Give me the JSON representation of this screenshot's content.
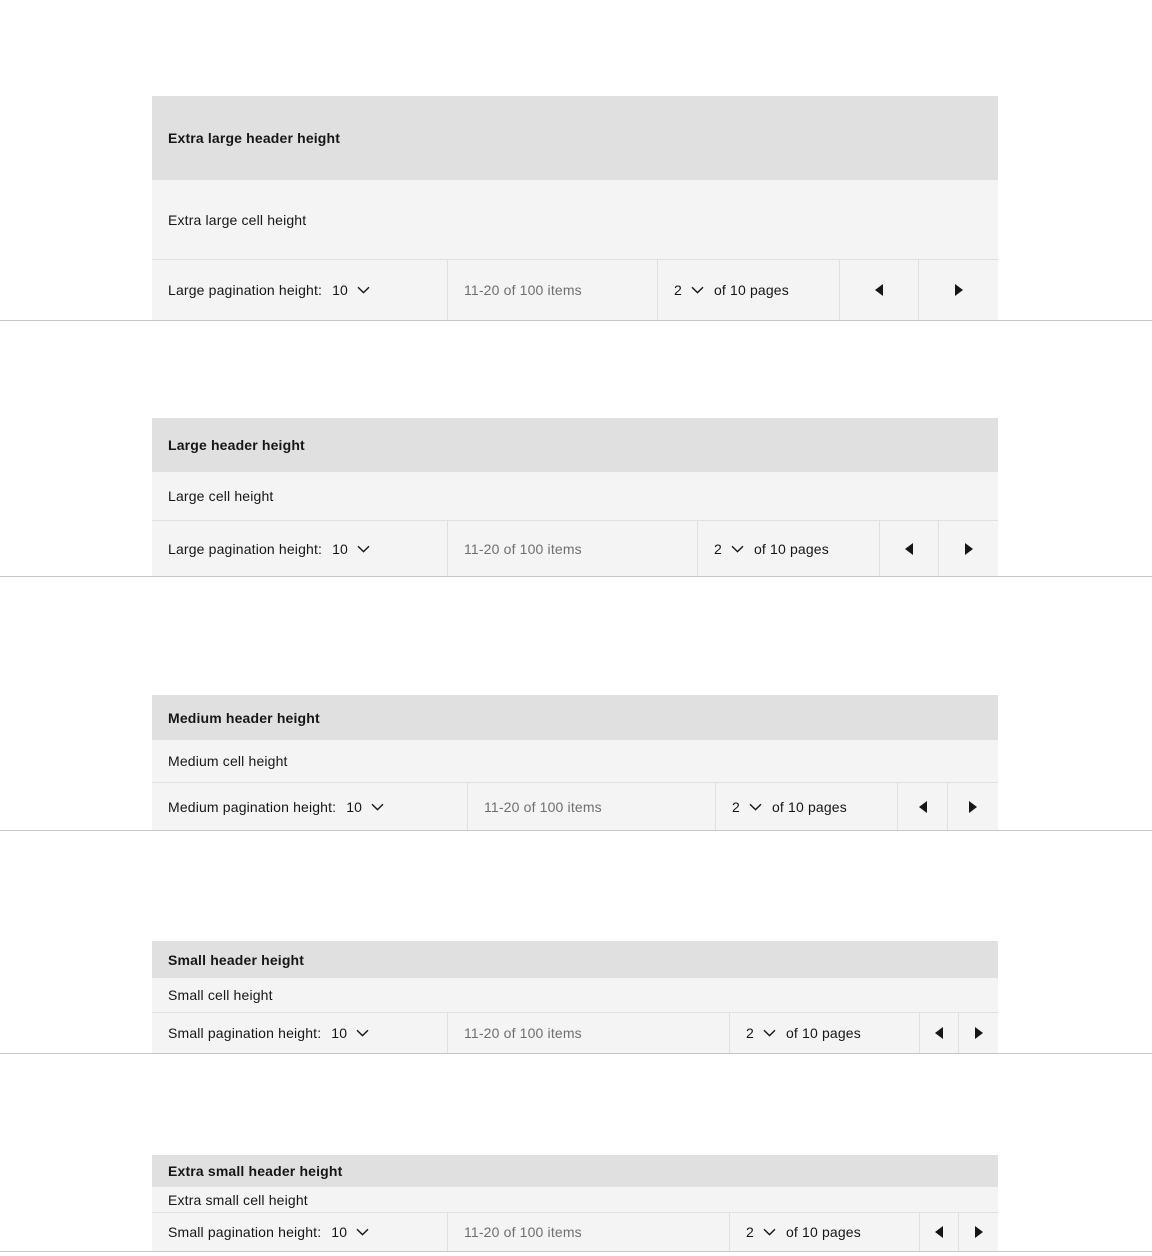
{
  "tables": [
    {
      "id": "xl",
      "header": "Extra large header height",
      "cell": "Extra large cell height",
      "pagination": {
        "page_size_label": "Large pagination height:",
        "page_size_value": "10",
        "item_range": "11-20 of 100 items",
        "page_value": "2",
        "page_total_label": "of 10 pages",
        "prev_label": "Previous page",
        "next_label": "Next page"
      }
    },
    {
      "id": "lg",
      "header": "Large header height",
      "cell": "Large cell height",
      "pagination": {
        "page_size_label": "Large pagination height:",
        "page_size_value": "10",
        "item_range": "11-20 of 100 items",
        "page_value": "2",
        "page_total_label": "of 10 pages",
        "prev_label": "Previous page",
        "next_label": "Next page"
      }
    },
    {
      "id": "md",
      "header": "Medium header height",
      "cell": "Medium cell height",
      "pagination": {
        "page_size_label": "Medium pagination height:",
        "page_size_value": "10",
        "item_range": "11-20 of 100 items",
        "page_value": "2",
        "page_total_label": "of 10 pages",
        "prev_label": "Previous page",
        "next_label": "Next page"
      }
    },
    {
      "id": "sm",
      "header": "Small header height",
      "cell": "Small cell height",
      "pagination": {
        "page_size_label": "Small pagination height:",
        "page_size_value": "10",
        "item_range": "11-20 of 100 items",
        "page_value": "2",
        "page_total_label": "of 10 pages",
        "prev_label": "Previous page",
        "next_label": "Next page"
      }
    },
    {
      "id": "xs",
      "header": "Extra small header height",
      "cell": "Extra small cell height",
      "pagination": {
        "page_size_label": "Small pagination height:",
        "page_size_value": "10",
        "item_range": "11-20 of 100 items",
        "page_value": "2",
        "page_total_label": "of 10 pages",
        "prev_label": "Previous page",
        "next_label": "Next page"
      }
    }
  ],
  "icons": {
    "chevron_down": "chevron-down-icon",
    "caret_left": "caret-left-icon",
    "caret_right": "caret-right-icon"
  },
  "colors": {
    "page_background": "#ffffff",
    "header_background": "#e0e0e0",
    "cell_background": "#f4f4f4",
    "border": "#e0e0e0",
    "rule": "#c6c6c6",
    "text_primary": "#161616",
    "text_secondary": "#6f6f6f"
  }
}
